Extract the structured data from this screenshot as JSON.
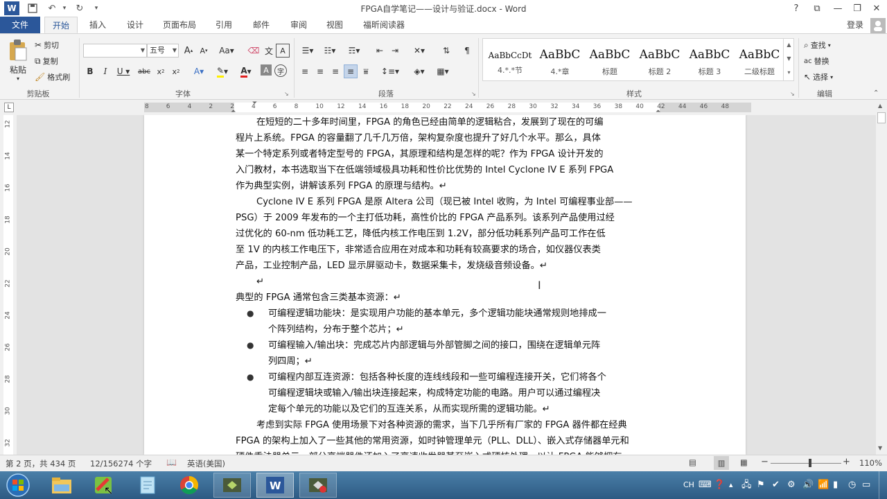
{
  "window": {
    "title": "FPGA自学笔记——设计与验证.docx - Word"
  },
  "quick_access": [
    "save-icon",
    "undo-icon",
    "redo-icon",
    "customize-icon"
  ],
  "window_controls": {
    "help": "?",
    "restore_ribbon": "⧉",
    "minimize": "—",
    "restore": "❐",
    "close": "✕"
  },
  "tabs": [
    {
      "label": "文件"
    },
    {
      "label": "开始"
    },
    {
      "label": "插入"
    },
    {
      "label": "设计"
    },
    {
      "label": "页面布局"
    },
    {
      "label": "引用"
    },
    {
      "label": "邮件"
    },
    {
      "label": "审阅"
    },
    {
      "label": "视图"
    },
    {
      "label": "福昕阅读器"
    }
  ],
  "user": {
    "login": "登录"
  },
  "ribbon": {
    "clipboard": {
      "paste": "粘贴",
      "cut": "剪切",
      "copy": "复制",
      "format_painter": "格式刷",
      "label": "剪贴板"
    },
    "font": {
      "font_name": "",
      "font_size": "五号",
      "label": "字体"
    },
    "paragraph": {
      "label": "段落"
    },
    "styles": {
      "label": "样式",
      "items": [
        {
          "preview": "AaBbCcDt",
          "name": "4.*.*节"
        },
        {
          "preview": "AaBbC",
          "name": "4.*章"
        },
        {
          "preview": "AaBbC",
          "name": "标题"
        },
        {
          "preview": "AaBbC",
          "name": "标题 2"
        },
        {
          "preview": "AaBbC",
          "name": "标题 3"
        },
        {
          "preview": "AaBbC",
          "name": "二级标题"
        }
      ]
    },
    "editing": {
      "find": "查找",
      "replace": "替换",
      "select": "选择",
      "label": "编辑"
    }
  },
  "ruler": {
    "h_ticks": [
      "8",
      "6",
      "4",
      "2",
      "2",
      "4",
      "6",
      "8",
      "10",
      "12",
      "14",
      "16",
      "18",
      "20",
      "22",
      "24",
      "26",
      "28",
      "30",
      "32",
      "34",
      "36",
      "38",
      "40",
      "42",
      "44",
      "46",
      "48"
    ],
    "v_ticks": [
      "12",
      "14",
      "16",
      "18",
      "20",
      "22",
      "24",
      "26",
      "28",
      "30",
      "32"
    ]
  },
  "document": {
    "lines": [
      {
        "text": "在短短的二十多年时间里，FPGA 的角色已经由简单的逻辑粘合，发展到了现在的可编",
        "indent": true
      },
      {
        "text": "程片上系统。FPGA 的容量翻了几千几万倍，架构复杂度也提升了好几个水平。那么，具体"
      },
      {
        "text": "某一个特定系列或者特定型号的 FPGA，其原理和结构是怎样的呢？作为 FPGA 设计开发的"
      },
      {
        "text": "入门教材，本书选取当下在低端领域极具功耗和性价比优势的 Intel Cyclone IV E 系列 FPGA"
      },
      {
        "text": "作为典型实例，讲解该系列 FPGA 的原理与结构。↵"
      },
      {
        "text": "Cyclone IV E 系列 FPGA 是原 Altera 公司（现已被 Intel 收购，为 Intel 可编程事业部——",
        "indent": true
      },
      {
        "text": "PSG）于 2009 年发布的一个主打低功耗，高性价比的 FPGA 产品系列。该系列产品使用过经"
      },
      {
        "text": "过优化的 60-nm 低功耗工艺，降低内核工作电压到 1.2V，部分低功耗系列产品可工作在低"
      },
      {
        "text": "至 1V 的内核工作电压下，非常适合应用在对成本和功耗有较高要求的场合，如仪器仪表类"
      },
      {
        "text": "产品，工业控制产品，LED 显示屏驱动卡，数据采集卡，发烧级音频设备。↵"
      },
      {
        "text": "↵",
        "indent": true
      },
      {
        "text": "典型的 FPGA 通常包含三类基本资源：↵"
      }
    ],
    "bullets": [
      {
        "lines": [
          "可编程逻辑功能块：是实现用户功能的基本单元，多个逻辑功能块通常规则地排成一",
          "个阵列结构，分布于整个芯片；↵"
        ]
      },
      {
        "lines": [
          "可编程输入/输出块：完成芯片内部逻辑与外部管脚之间的接口，围绕在逻辑单元阵",
          "列四周；↵"
        ]
      },
      {
        "lines": [
          "可编程内部互连资源：包括各种长度的连线线段和一些可编程连接开关，它们将各个",
          "可编程逻辑块或输入/输出块连接起来，构成特定功能的电路。用户可以通过编程决",
          "定每个单元的功能以及它们的互连关系，从而实现所需的逻辑功能。↵"
        ]
      }
    ],
    "tail": [
      {
        "text": "考虑到实际 FPGA 使用场景下对各种资源的需求，当下几乎所有厂家的 FPGA 器件都在经典",
        "indent": true
      },
      {
        "text": "FPGA 的架构上加入了一些其他的常用资源，如时钟管理单元（PLL、DLL）、嵌入式存储器单元和"
      },
      {
        "text": "硬件乘法器单元，部分高端器件还加入了高速收发器甚至嵌入式硬核处理，以让 FPGA 能够拥有"
      }
    ]
  },
  "status": {
    "page": "第 2 页，共 434 页",
    "words": "12/156274 个字",
    "language": "英语(美国)",
    "zoom": "110%",
    "zoom_level": 0.55
  },
  "taskbar": {
    "apps": [
      "start-icon",
      "explorer-icon",
      "paint-icon",
      "notepad-icon",
      "chrome-icon",
      "app-icon",
      "word-icon",
      "app2-icon"
    ],
    "ime": "CH"
  }
}
